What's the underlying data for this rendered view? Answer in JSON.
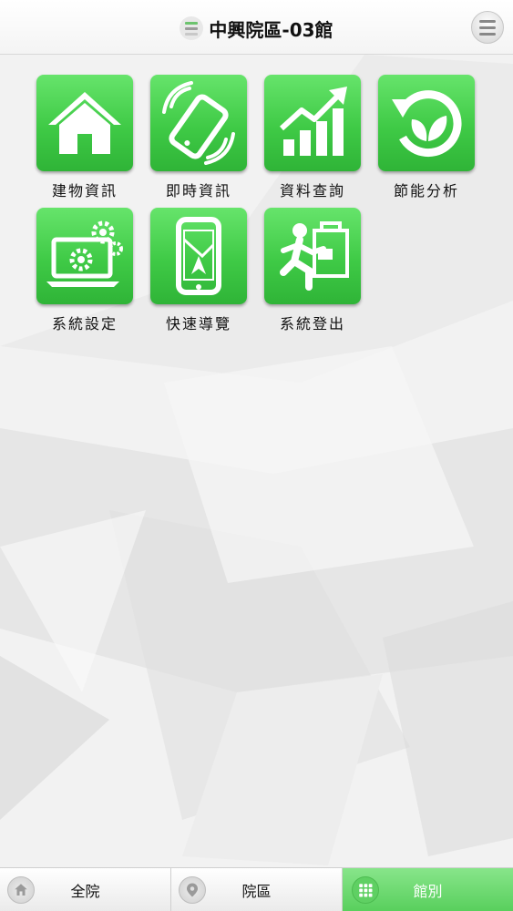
{
  "header": {
    "title": "中興院區-03館",
    "badge_colors": [
      "#6cc36e",
      "#9b9b9b",
      "#c8c8c8"
    ],
    "badge_icon": "building-badge-icon",
    "menu_icon": "hamburger-menu-icon"
  },
  "tiles": [
    {
      "label": "建物資訊",
      "icon": "house-icon"
    },
    {
      "label": "即時資訊",
      "icon": "phone-vibrate-icon"
    },
    {
      "label": "資料查詢",
      "icon": "bar-chart-growth-icon"
    },
    {
      "label": "節能分析",
      "icon": "leaf-cycle-icon"
    },
    {
      "label": "系統設定",
      "icon": "laptop-gears-icon"
    },
    {
      "label": "快速導覽",
      "icon": "phone-map-icon"
    },
    {
      "label": "系統登出",
      "icon": "running-exit-icon"
    }
  ],
  "bottom_tabs": [
    {
      "label": "全院",
      "icon": "home-icon",
      "active": false
    },
    {
      "label": "院區",
      "icon": "location-pin-icon",
      "active": false
    },
    {
      "label": "館別",
      "icon": "grid-icon",
      "active": true
    }
  ],
  "colors": {
    "tile_green": "#4dd152",
    "active_tab": "#6fd872",
    "background": "#f1f1f1"
  }
}
